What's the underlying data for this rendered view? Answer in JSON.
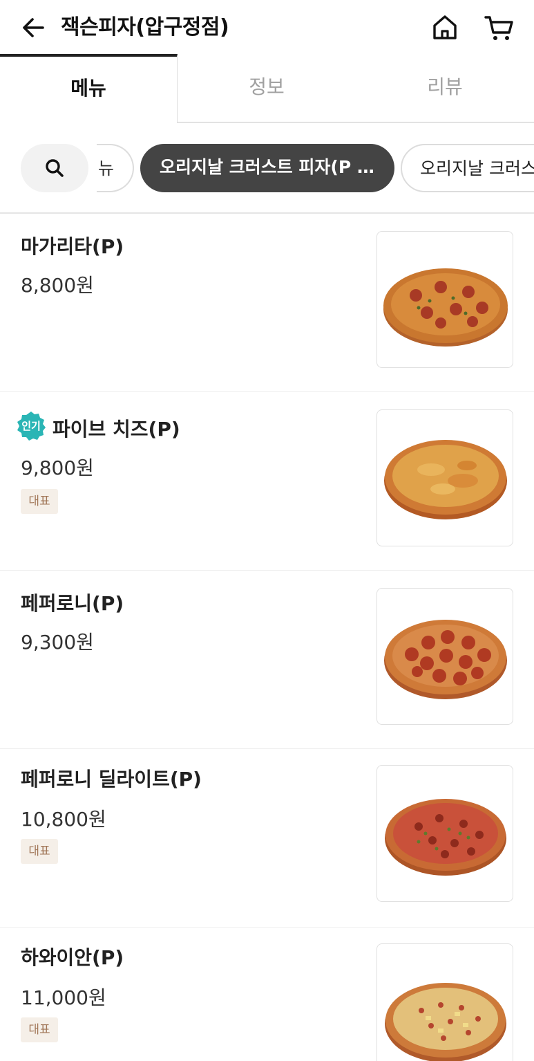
{
  "header": {
    "title": "잭슨피자(압구정점)",
    "back_icon": "arrow-left-icon",
    "home_icon": "home-icon",
    "cart_icon": "cart-icon"
  },
  "tabs": [
    {
      "label": "메뉴",
      "active": true
    },
    {
      "label": "정보",
      "active": false
    },
    {
      "label": "리뷰",
      "active": false
    }
  ],
  "categories": {
    "search_icon": "search-icon",
    "partial_label": "뉴",
    "active_label": "오리지날 크러스트 피자(P …",
    "next_label": "오리지날 크러스트 피자(M)"
  },
  "colors": {
    "active_chip": "#444444",
    "popular_badge": "#2ab5b5",
    "rep_badge_bg": "#f5efe8",
    "rep_badge_text": "#a07556"
  },
  "menu": [
    {
      "name": "마가리타(P)",
      "price": "8,800원",
      "popular": false,
      "badge": ""
    },
    {
      "name": "파이브 치즈(P)",
      "price": "9,800원",
      "popular": true,
      "popular_label": "인기",
      "badge": "대표"
    },
    {
      "name": "페퍼로니(P)",
      "price": "9,300원",
      "popular": false,
      "badge": ""
    },
    {
      "name": "페퍼로니 딜라이트(P)",
      "price": "10,800원",
      "popular": false,
      "badge": "대표"
    },
    {
      "name": "하와이안(P)",
      "price": "11,000원",
      "popular": false,
      "badge": "대표"
    }
  ]
}
